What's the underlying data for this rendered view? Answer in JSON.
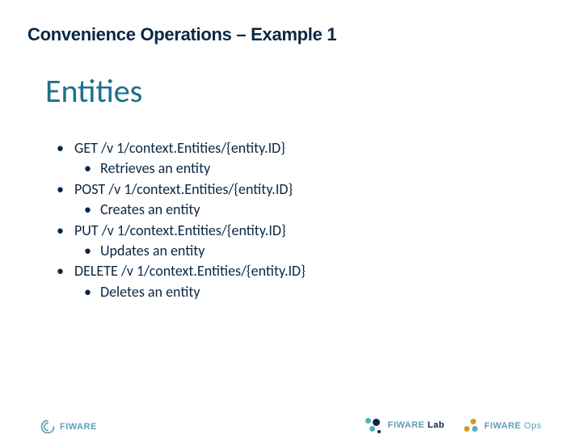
{
  "slide": {
    "title": "Convenience Operations – Example 1",
    "section_title": "Entities"
  },
  "bullets": [
    {
      "l1": "GET /v 1/context.Entities/{entity.ID}",
      "l2": "Retrieves an entity"
    },
    {
      "l1": "POST /v 1/context.Entities/{entity.ID}",
      "l2": "Creates an entity"
    },
    {
      "l1": "PUT /v 1/context.Entities/{entity.ID}",
      "l2": "Updates an entity"
    },
    {
      "l1": "DELETE /v 1/context.Entities/{entity.ID}",
      "l2": "Deletes an entity"
    }
  ],
  "footer": {
    "brand": "FIWARE",
    "lab": "Lab",
    "ops": "Ops"
  }
}
